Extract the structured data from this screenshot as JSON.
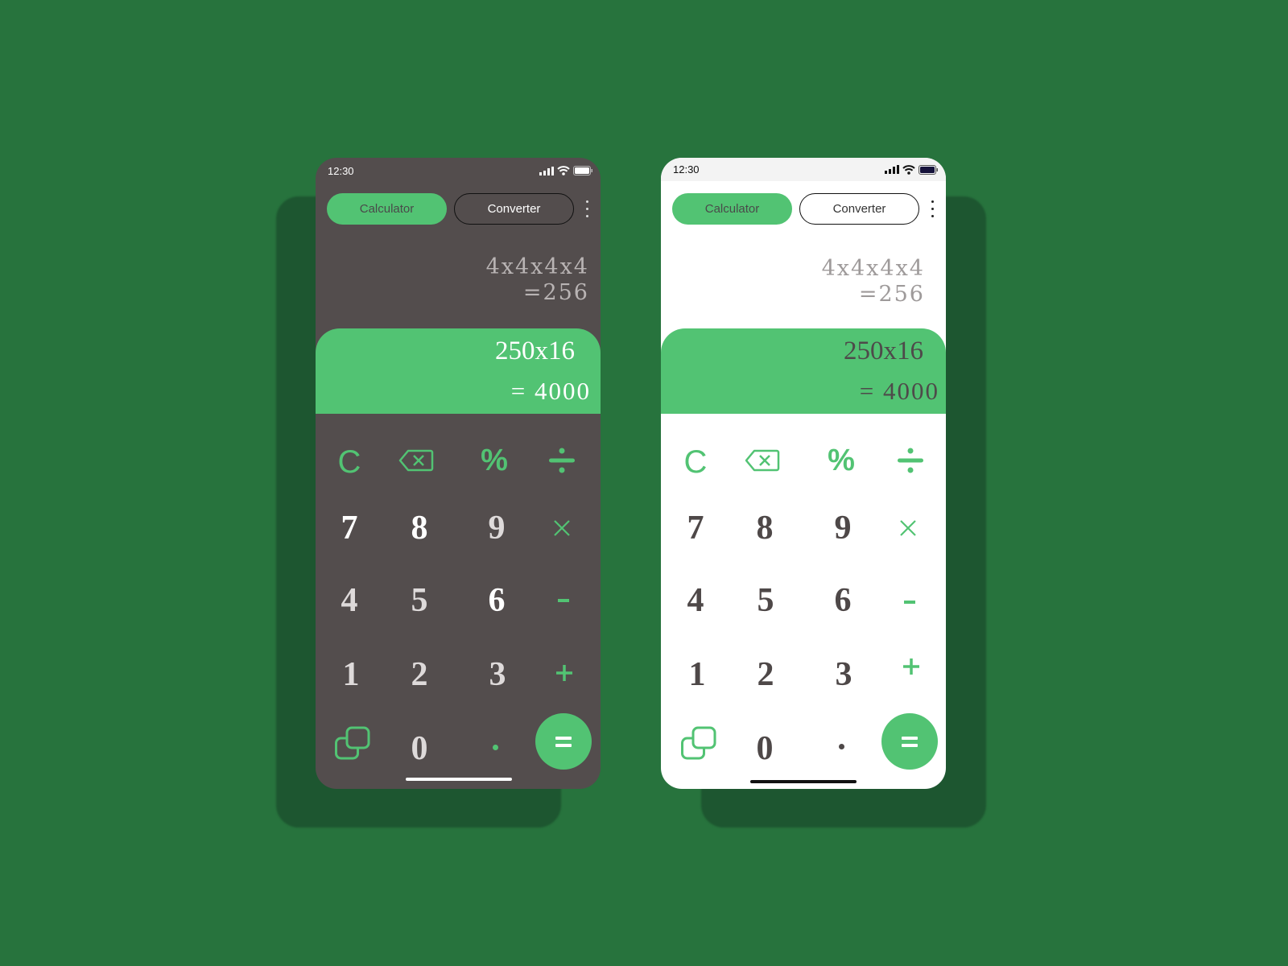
{
  "colors": {
    "background": "#27733d",
    "accent": "#52c373",
    "dark_surface": "#534d4d",
    "light_surface": "#ffffff"
  },
  "phones": [
    {
      "theme": "dark",
      "status": {
        "time": "12:30",
        "icons": [
          "signal-icon",
          "wifi-icon",
          "battery-icon"
        ]
      },
      "tabs": [
        {
          "label": "Calculator",
          "active": true
        },
        {
          "label": "Converter",
          "active": false
        }
      ],
      "history": {
        "expression": "4x4x4x4",
        "result": "=256"
      },
      "display": {
        "expression": "250x16",
        "result": "= 4000"
      },
      "keys": {
        "clear": "C",
        "backspace": "backspace-icon",
        "percent": "%",
        "divide": "÷",
        "seven": "7",
        "eight": "8",
        "nine": "9",
        "multiply": "×",
        "four": "4",
        "five": "5",
        "six": "6",
        "minus": "-",
        "one": "1",
        "two": "2",
        "three": "3",
        "plus": "+",
        "mode": "layers-icon",
        "zero": "0",
        "decimal": ".",
        "equals": "="
      }
    },
    {
      "theme": "light",
      "status": {
        "time": "12:30",
        "icons": [
          "signal-icon",
          "wifi-icon",
          "battery-icon"
        ]
      },
      "tabs": [
        {
          "label": "Calculator",
          "active": true
        },
        {
          "label": "Converter",
          "active": false
        }
      ],
      "history": {
        "expression": "4x4x4x4",
        "result": "=256"
      },
      "display": {
        "expression": "250x16",
        "result": "= 4000"
      },
      "keys": {
        "clear": "C",
        "backspace": "backspace-icon",
        "percent": "%",
        "divide": "÷",
        "seven": "7",
        "eight": "8",
        "nine": "9",
        "multiply": "×",
        "four": "4",
        "five": "5",
        "six": "6",
        "minus": "-",
        "one": "1",
        "two": "2",
        "three": "3",
        "plus": "+",
        "mode": "layers-icon",
        "zero": "0",
        "decimal": ".",
        "equals": "="
      }
    }
  ]
}
